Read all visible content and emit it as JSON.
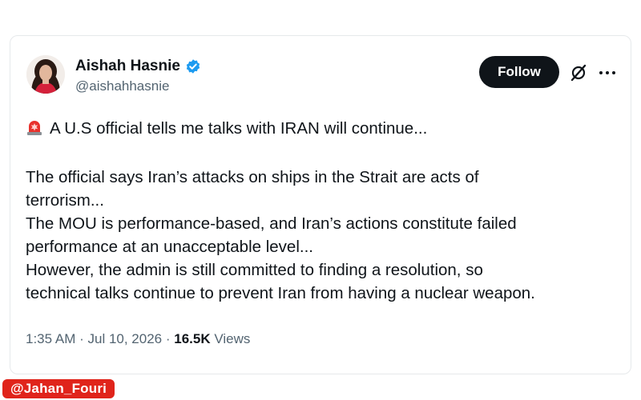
{
  "author": {
    "name": "Aishah Hasnie",
    "handle": "@aishahhasnie",
    "verified": true,
    "avatar": "woman-avatar"
  },
  "actions": {
    "follow_label": "Follow",
    "grok_icon": "grok-icon",
    "more_icon": "more-options-icon"
  },
  "tweet": {
    "headline_icon": "siren-emoji",
    "lines": [
      "A U.S official tells me talks with IRAN will continue...",
      "",
      "The official says Iran’s attacks on ships in the Strait are acts of",
      "terrorism...",
      "The MOU is performance-based, and Iran’s actions constitute failed",
      "performance at an unacceptable level...",
      "However, the admin is still committed to finding a resolution, so",
      "technical talks continue to prevent Iran from having a nuclear weapon."
    ]
  },
  "meta": {
    "time": "1:35 AM",
    "separator": " · ",
    "date": "Jul 10, 2026",
    "views_count": "16.5K",
    "views_label": "Views"
  },
  "watermark": "@Jahan_Fouri",
  "colors": {
    "follow_bg": "#0f1419",
    "verified": "#1d9bf0",
    "secondary_text": "#536471",
    "watermark_bg": "#e0241b"
  }
}
